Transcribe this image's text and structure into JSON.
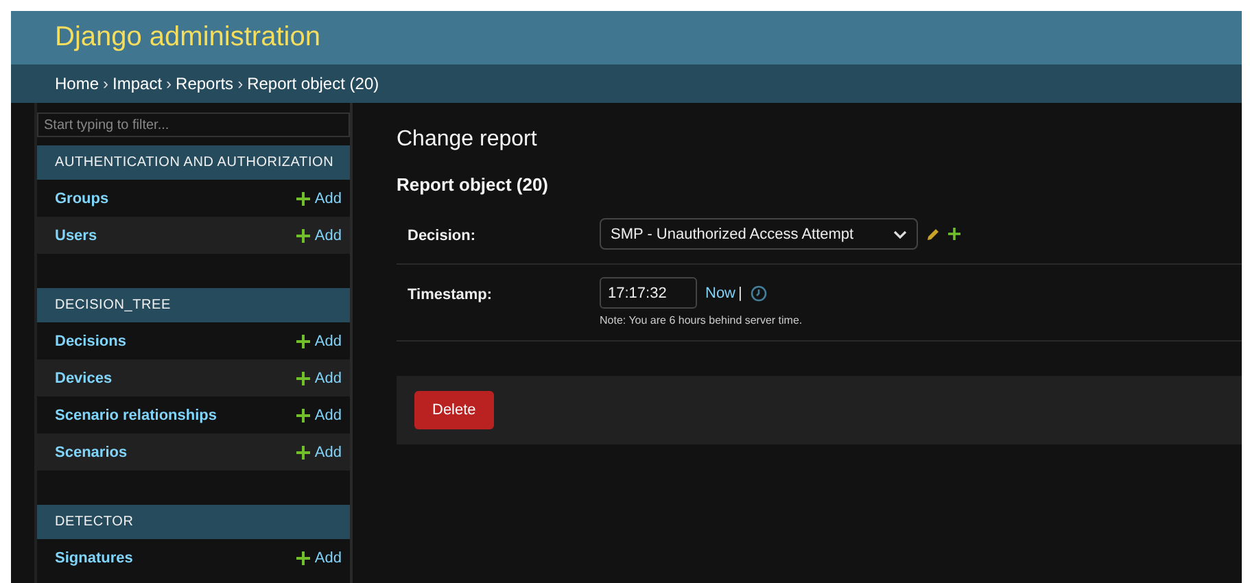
{
  "header": {
    "title": "Django administration"
  },
  "breadcrumbs": {
    "separator": "›",
    "items": [
      "Home",
      "Impact",
      "Reports",
      "Report object (20)"
    ]
  },
  "sidebar": {
    "filter": {
      "placeholder": "Start typing to filter..."
    },
    "modules": [
      {
        "title": "AUTHENTICATION AND AUTHORIZATION",
        "models": [
          {
            "name": "Groups",
            "add": "Add"
          },
          {
            "name": "Users",
            "add": "Add"
          }
        ]
      },
      {
        "title": "DECISION_TREE",
        "models": [
          {
            "name": "Decisions",
            "add": "Add"
          },
          {
            "name": "Devices",
            "add": "Add"
          },
          {
            "name": "Scenario relationships",
            "add": "Add"
          },
          {
            "name": "Scenarios",
            "add": "Add"
          }
        ]
      },
      {
        "title": "DETECTOR",
        "models": [
          {
            "name": "Signatures",
            "add": "Add"
          }
        ]
      }
    ]
  },
  "content": {
    "title": "Change report",
    "object": "Report object (20)",
    "fields": [
      {
        "kind": "select",
        "label": "Decision:",
        "value": "SMP - Unauthorized Access Attempt"
      },
      {
        "kind": "time",
        "label": "Timestamp:",
        "value": "17:17:32",
        "now": "Now",
        "separator": "|",
        "note": "Note: You are 6 hours behind server time."
      }
    ],
    "delete": "Delete"
  }
}
